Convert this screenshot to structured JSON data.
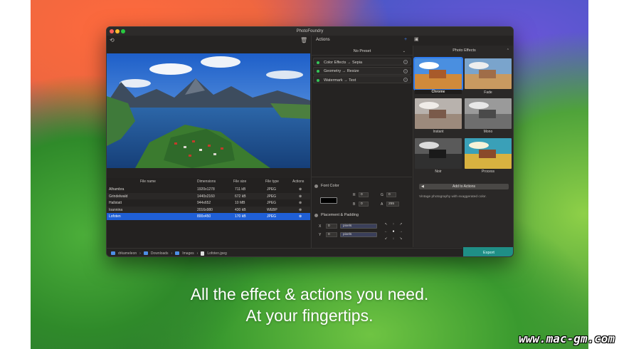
{
  "window": {
    "title": "PhotoFoundry"
  },
  "actions_panel": {
    "title": "Actions",
    "preset": "No Preset",
    "items": [
      {
        "label": "Color Effects → Sepia"
      },
      {
        "label": "Geometry → Resize"
      },
      {
        "label": "Watermark → Text"
      }
    ]
  },
  "properties": {
    "font_color": {
      "label": "Font Color",
      "r_label": "R",
      "r": "0",
      "g_label": "G",
      "g": "0",
      "b_label": "B",
      "b": "0",
      "a_label": "A",
      "a": "255",
      "swatch": "#000000"
    },
    "placement": {
      "label": "Placement & Padding",
      "x_label": "X",
      "x": "0",
      "x_unit": "pixels",
      "y_label": "Y",
      "y": "0",
      "y_unit": "pixels"
    }
  },
  "effects_panel": {
    "dropdown": "Photo Effects",
    "thumbs": [
      {
        "label": "Chrome",
        "selected": true
      },
      {
        "label": "Fade"
      },
      {
        "label": "Instant"
      },
      {
        "label": "Mono"
      },
      {
        "label": "Noir"
      },
      {
        "label": "Process"
      }
    ],
    "add_button": "Add to Actions",
    "description": "Vintage photography with exaggerated color."
  },
  "table": {
    "headers": [
      "File name",
      "Dimensions",
      "File size",
      "File type",
      "Actions"
    ],
    "rows": [
      {
        "name": "Alhambra",
        "dims": "1920x1278",
        "size": "711 kB",
        "type": "JPEG"
      },
      {
        "name": "Grindelwald",
        "dims": "1440x2160",
        "size": "672 kB",
        "type": "JPEG"
      },
      {
        "name": "Hallstatt",
        "dims": "944x652",
        "size": "10 MB",
        "type": "JPEG"
      },
      {
        "name": "Ioannina",
        "dims": "2016x980",
        "size": "430 kB",
        "type": "WEBP"
      },
      {
        "name": "Lofoten",
        "dims": "800x450",
        "size": "170 kB",
        "type": "JPEG",
        "selected": true
      }
    ]
  },
  "pathbar": {
    "segments": [
      "drkameleon",
      "Downloads",
      "Images",
      "Lofoten.jpeg"
    ]
  },
  "export_button": "Export",
  "caption": {
    "line1": "All the effect & actions you need.",
    "line2": "At your fingertips."
  },
  "watermark": "www.mac-gm.com",
  "colors": {
    "accent": "#1f5fd6",
    "export": "#1f8f86",
    "status_dot": "#35c759"
  }
}
